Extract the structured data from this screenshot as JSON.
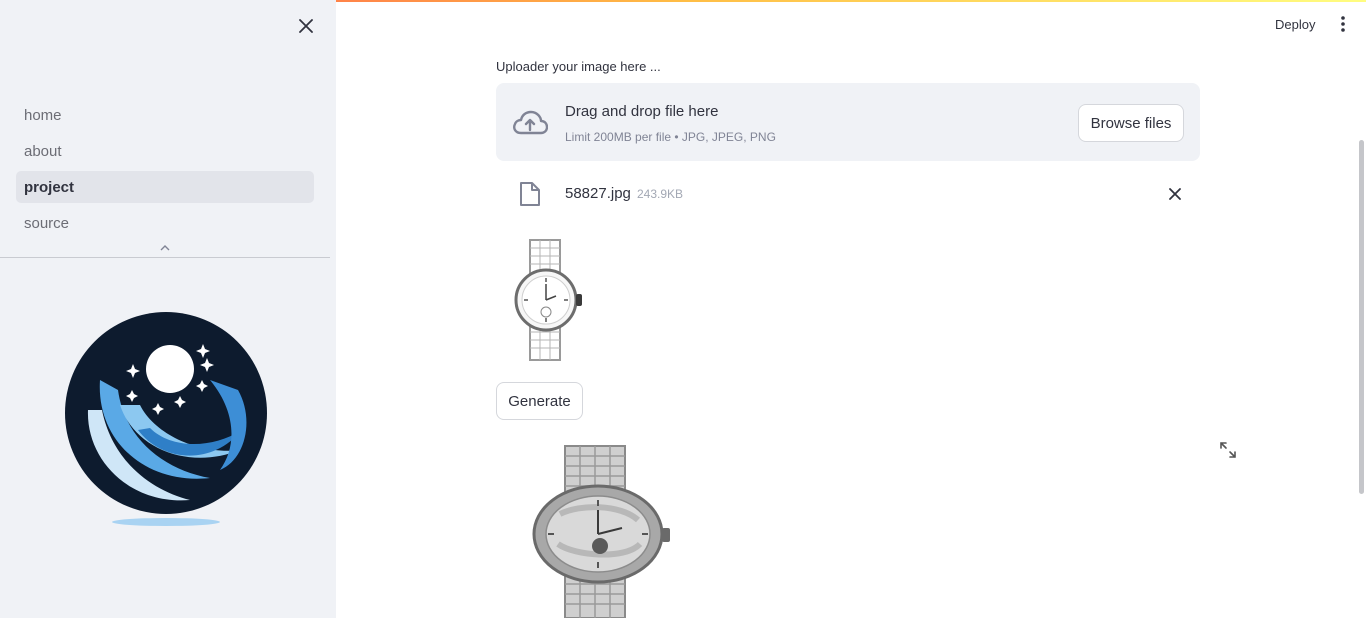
{
  "sidebar": {
    "nav_items": [
      {
        "label": "home",
        "active": false
      },
      {
        "label": "about",
        "active": false
      },
      {
        "label": "project",
        "active": true
      },
      {
        "label": "source",
        "active": false
      }
    ],
    "icons": {
      "close": "close-icon",
      "collapse": "chevron-up-icon",
      "logo": "moon-stars-logo"
    }
  },
  "header": {
    "deploy_label": "Deploy",
    "menu_icon": "kebab-menu-icon"
  },
  "uploader": {
    "label": "Uploader your image here ...",
    "drop_title": "Drag and drop file here",
    "drop_subtitle": "Limit 200MB per file • JPG, JPEG, PNG",
    "browse_label": "Browse files",
    "icon": "cloud-upload-icon"
  },
  "uploaded_file": {
    "name": "58827.jpg",
    "size": "243.9KB",
    "icon": "file-icon",
    "remove_icon": "close-icon"
  },
  "actions": {
    "generate_label": "Generate",
    "fullscreen_icon": "fullscreen-icon"
  },
  "colors": {
    "sidebar_bg": "#f0f2f6",
    "accent_gradient": [
      "#ff4b4b",
      "#ffbd45",
      "#fffd80"
    ],
    "text": "#31333f",
    "muted": "#808495"
  }
}
